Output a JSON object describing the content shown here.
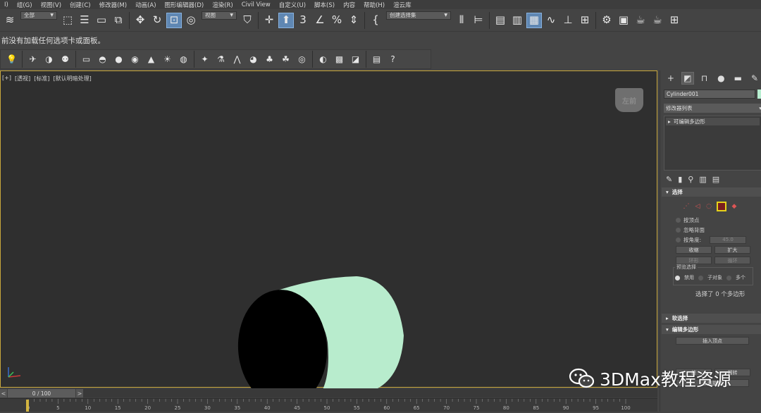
{
  "menu": [
    "I)",
    "组(G)",
    "视图(V)",
    "创建(C)",
    "修改器(M)",
    "动画(A)",
    "图形编辑器(D)",
    "渲染(R)",
    "Civil View",
    "自定义(U)",
    "脚本(S)",
    "内容",
    "帮助(H)",
    "渲云库"
  ],
  "toolbar": {
    "filter_value": "全部",
    "refcoord_value": "视图",
    "named_selection_value": "创建选择集",
    "percent_icon": "%",
    "angle_icon": "∠",
    "snap_label": "3"
  },
  "notice": "前没有加载任何选项卡或面板。",
  "viewport": {
    "label_plus": "[+]",
    "label_view": "[透视]",
    "label_shading": "[标准]",
    "label_light": "[默认明暗处理]",
    "viewcube_text": "左前"
  },
  "timeline": {
    "frame_display": "0 / 100",
    "prev": "<",
    "next": ">",
    "ticks": [
      "0",
      "5",
      "10",
      "15",
      "20",
      "25",
      "30",
      "35",
      "40",
      "45",
      "50",
      "55",
      "60",
      "65",
      "70",
      "75",
      "80",
      "85",
      "90",
      "95",
      "100"
    ]
  },
  "command_panel": {
    "object_name": "Cylinder001",
    "modifier_list": "修改器列表",
    "stack_item": "可编辑多边形",
    "rollout_select": "选择",
    "by_vertex": "按顶点",
    "ignore_backface": "忽略背面",
    "by_angle": "按角度:",
    "angle_value": "45.0",
    "shrink": "收缩",
    "grow": "扩大",
    "ring": "环形",
    "loop": "循环",
    "preview_selection": "预览选择",
    "disabled": "禁用",
    "subobject": "子对象",
    "multi": "多个",
    "selected_info": "选择了 0 个多边形",
    "rollout_soft": "软选择",
    "rollout_edit": "编辑多边形",
    "insert_vertex": "插入顶点",
    "flip": "翻转",
    "from_edge": "从边旋转",
    "unknown_btn": "挤"
  },
  "watermark": "3DMax教程资源",
  "colors": {
    "cylinder": "#b8eccd",
    "viewport_border": "#c9a83c",
    "active_subobj": "#e6d21a"
  }
}
